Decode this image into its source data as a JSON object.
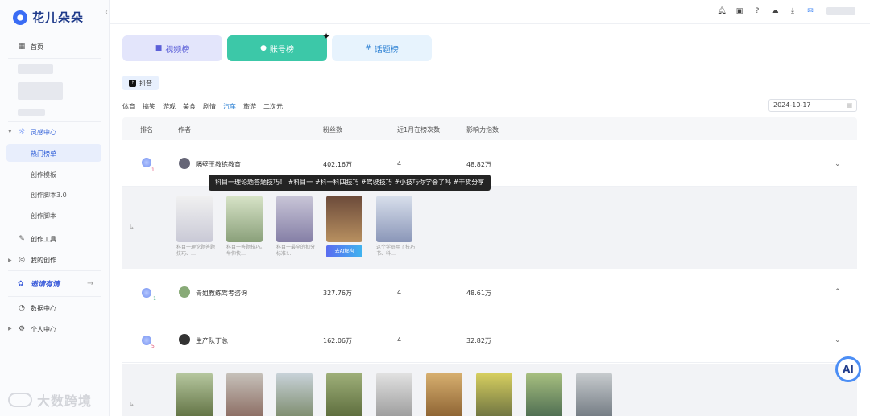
{
  "app": {
    "brand": "花儿朵朵"
  },
  "sidebar": {
    "home": "首页",
    "inspiration": "灵感中心",
    "sub_items": [
      "热门榜单",
      "创作模板",
      "创作脚本3.0",
      "创作脚本"
    ],
    "create_tools": "创作工具",
    "my_creations": "我的创作",
    "promo": "邀请有请",
    "data_center": "数据中心",
    "personal_center": "个人中心"
  },
  "tabs": {
    "video": "视频榜",
    "account": "账号榜",
    "topic": "话题榜"
  },
  "platform": {
    "label": "抖音",
    "icon": "tiktok-icon"
  },
  "categories": [
    "体育",
    "搞笑",
    "游戏",
    "美食",
    "剧情",
    "汽车",
    "旅游",
    "二次元"
  ],
  "active_category": "汽车",
  "date": "2024-10-17",
  "table": {
    "headers": [
      "排名",
      "作者",
      "粉丝数",
      "近1月在榜次数",
      "影响力指数"
    ],
    "rows": [
      {
        "rank_change": "1",
        "author": "隔壁王教练教育",
        "fans": "402.16万",
        "count": "4",
        "influence": "48.82万"
      },
      {
        "rank_change": "-1",
        "author": "青姐教练驾考咨询",
        "fans": "327.76万",
        "count": "4",
        "influence": "48.61万"
      },
      {
        "rank_change": "5",
        "author": "生产队丁总",
        "fans": "162.06万",
        "count": "4",
        "influence": "32.82万"
      }
    ],
    "tooltip": "科目一理论题答题技巧！ #科目一 #科一科四技巧 #驾驶技巧 #小技巧你学会了吗 #干货分享",
    "captions": [
      "科目一理论题答题技巧、…",
      "科目一答题技巧。举你快…",
      "科目一最全的扣分标准!…",
      "",
      "这个学员用了技巧书、科…"
    ],
    "ai_button": "去AI解构"
  },
  "ai_float": "AI",
  "watermark": "大数跨境",
  "colors": {
    "accent": "#3cc8a8",
    "link": "#2a7fd3",
    "brand": "#3a6cf4"
  }
}
